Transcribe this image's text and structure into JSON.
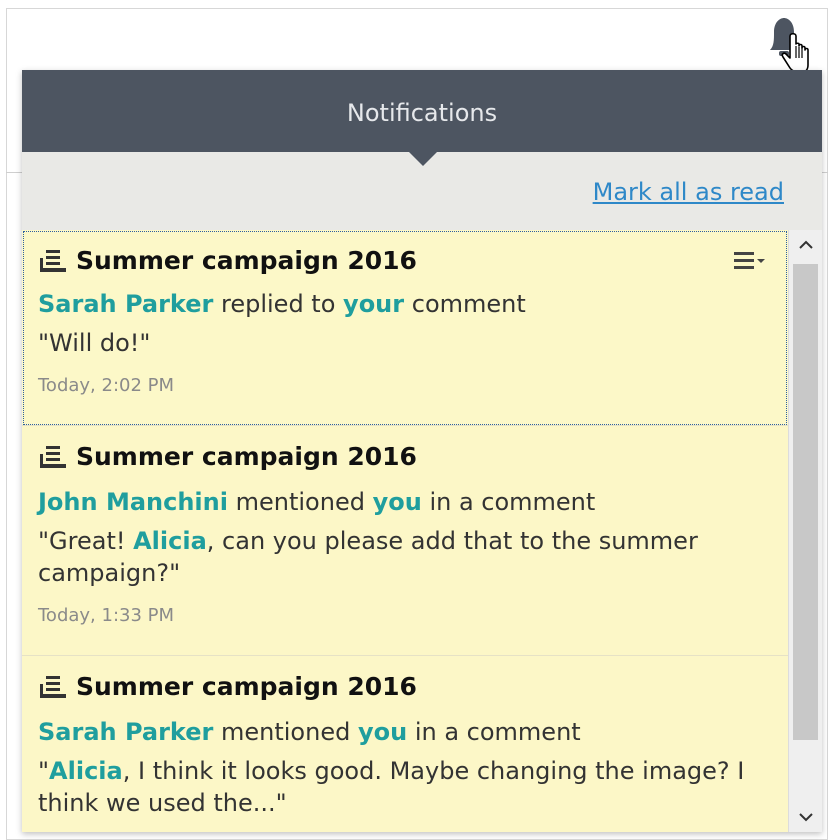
{
  "header": {
    "title": "Notifications"
  },
  "actions": {
    "mark_all_label": "Mark all as read"
  },
  "notifications": [
    {
      "title": "Summer campaign 2016",
      "actor": "Sarah Parker",
      "verb": "replied to",
      "target": "your",
      "suffix": "comment",
      "quote_prefix": "\"Will do!\"",
      "quote_mention": "",
      "quote_rest": "",
      "time": "Today, 2:02 PM"
    },
    {
      "title": "Summer campaign 2016",
      "actor": "John Manchini",
      "verb": "mentioned",
      "target": "you",
      "suffix": "in a comment",
      "quote_prefix": "\"Great! ",
      "quote_mention": "Alicia",
      "quote_rest": ", can you please add that to the summer campaign?\"",
      "time": "Today, 1:33 PM"
    },
    {
      "title": "Summer campaign 2016",
      "actor": "Sarah Parker",
      "verb": "mentioned",
      "target": "you",
      "suffix": "in a comment",
      "quote_prefix": "\"",
      "quote_mention": "Alicia",
      "quote_rest": ", I think it looks good. Maybe changing the image? I think we used the...\"",
      "time": ""
    }
  ],
  "colors": {
    "header_bg": "#4d5561",
    "item_bg": "#fcf7c7",
    "highlight": "#1f9e9e",
    "link": "#2e88c8"
  },
  "icons": {
    "bell": "bell-icon",
    "cursor": "hand-pointer-icon",
    "document": "document-stack-icon",
    "menu": "item-menu-icon",
    "scroll_up": "chevron-up-icon",
    "scroll_down": "chevron-down-icon"
  }
}
